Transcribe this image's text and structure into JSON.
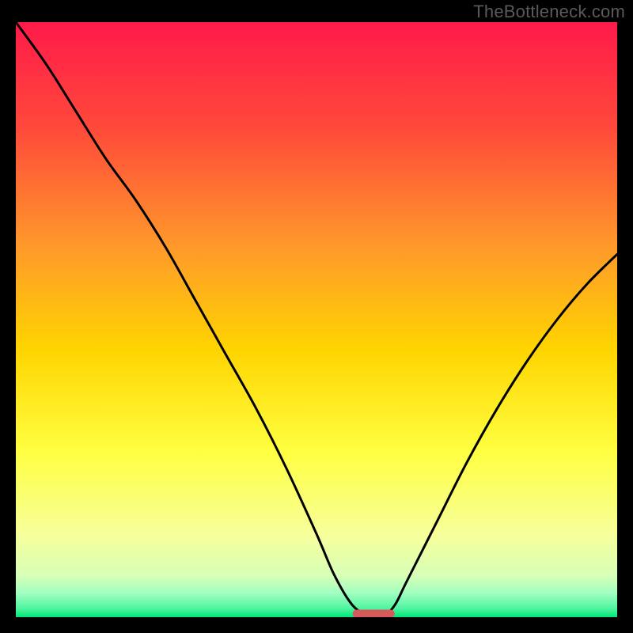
{
  "watermark": "TheBottleneck.com",
  "chart_data": {
    "type": "line",
    "title": "",
    "xlabel": "",
    "ylabel": "",
    "xlim": [
      0,
      100
    ],
    "ylim": [
      0,
      100
    ],
    "grid": false,
    "legend": false,
    "background_gradient": [
      "#ff1a4a",
      "#ff7a2a",
      "#ffd400",
      "#ffff66",
      "#f5ffb0",
      "#7fffb0",
      "#00e47a"
    ],
    "series": [
      {
        "name": "bottleneck-curve",
        "color": "#000000",
        "x": [
          0,
          5,
          10,
          15,
          20,
          25,
          30,
          35,
          40,
          45,
          50,
          53,
          56,
          59,
          61,
          63,
          65,
          70,
          75,
          80,
          85,
          90,
          95,
          100
        ],
        "values": [
          100,
          93,
          85,
          77,
          70,
          62,
          53,
          44,
          35,
          25,
          14,
          7,
          2,
          0,
          0,
          2,
          6,
          16,
          26,
          35,
          43,
          50,
          56,
          61
        ]
      }
    ],
    "marker": {
      "name": "optimal-range",
      "color": "#d65a5a",
      "x_start": 56,
      "x_end": 63,
      "y": 0.6
    }
  }
}
